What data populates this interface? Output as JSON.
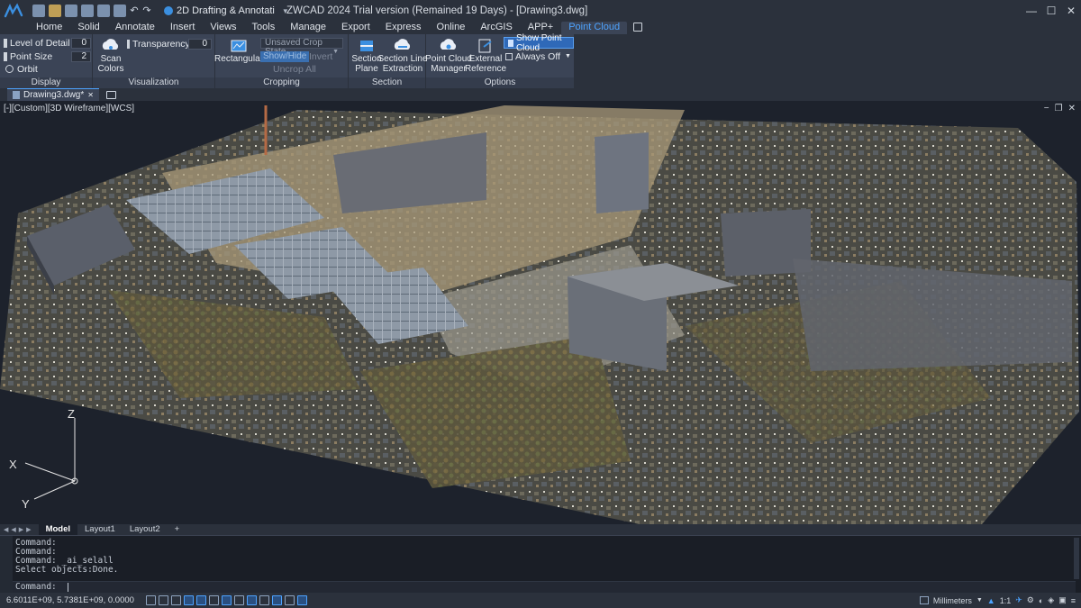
{
  "titlebar": {
    "workspace": "2D Drafting & Annotati",
    "title": "ZWCAD 2024 Trial version (Remained 19 Days) - [Drawing3.dwg]",
    "undo_glyph": "↶",
    "redo_glyph": "↷"
  },
  "ribbon_tabs": [
    "Home",
    "Solid",
    "Annotate",
    "Insert",
    "Views",
    "Tools",
    "Manage",
    "Export",
    "Express",
    "Online",
    "ArcGIS",
    "APP+",
    "Point Cloud"
  ],
  "ribbon": {
    "display": {
      "label": "Display",
      "level_of_detail_label": "Level of Detail",
      "level_of_detail_value": "0",
      "point_size_label": "Point Size",
      "point_size_value": "2",
      "orbit_label": "Orbit"
    },
    "visualization": {
      "label": "Visualization",
      "scan_colors_label_1": "Scan",
      "scan_colors_label_2": "Colors",
      "transparency_label": "Transparency",
      "transparency_value": "0"
    },
    "cropping": {
      "label": "Cropping",
      "rectangular_label": "Rectangular",
      "crop_state": "Unsaved Crop State",
      "show_hide": "Show/Hide",
      "invert": "Invert",
      "uncrop_all": "Uncrop All"
    },
    "section": {
      "label": "Section",
      "section_plane_1": "Section",
      "section_plane_2": "Plane",
      "section_line_1": "Section Line",
      "section_line_2": "Extraction"
    },
    "options": {
      "label": "Options",
      "manager_1": "Point Cloud",
      "manager_2": "Manager",
      "external_1": "External",
      "external_2": "Reference",
      "show_point_cloud": "Show Point Cloud",
      "always_off": "Always Off"
    }
  },
  "document": {
    "tab": "Drawing3.dwg*"
  },
  "viewport": {
    "label": "[-][Custom][3D Wireframe][WCS]",
    "axis_z": "Z",
    "axis_x": "X",
    "axis_y": "Y"
  },
  "layout_tabs": [
    "Model",
    "Layout1",
    "Layout2",
    "+"
  ],
  "command": {
    "history": [
      "Command:",
      "Command:",
      "Command: _ai_selall",
      "Select objects:Done."
    ],
    "prompt": "Command:"
  },
  "status": {
    "coords": "6.6011E+09, 5.7381E+09, 0.0000",
    "units": "Millimeters",
    "scale": "1:1"
  },
  "colors": {
    "accent": "#4da3ff",
    "ribbon_bg": "#3b4456",
    "chrome_bg": "#2b313c",
    "viewport_bg": "#1d222c"
  }
}
